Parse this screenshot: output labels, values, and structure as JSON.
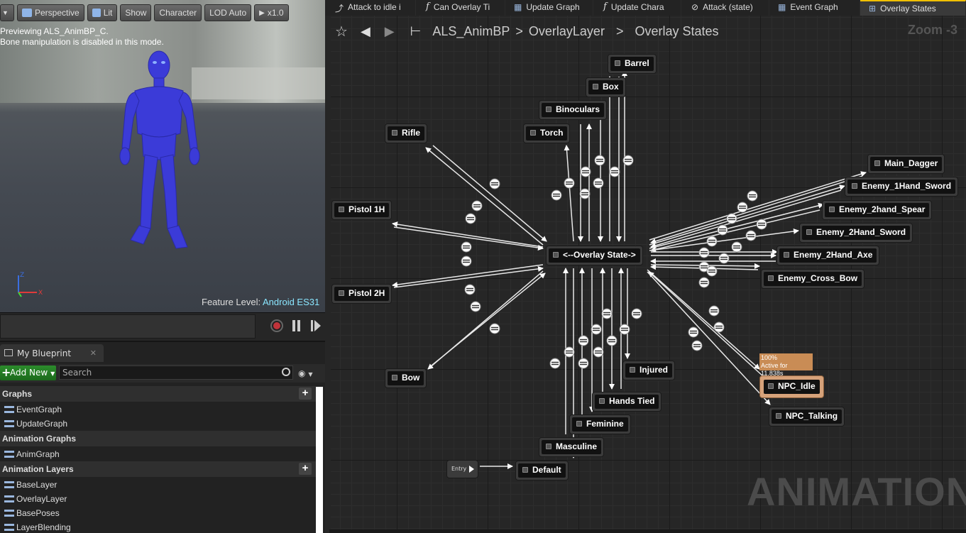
{
  "viewport": {
    "toolbar": {
      "perspective": "Perspective",
      "lit": "Lit",
      "show": "Show",
      "character": "Character",
      "lod": "LOD Auto",
      "speed": "x1.0"
    },
    "info_line1": "Previewing ALS_AnimBP_C.",
    "info_line2": "Bone manipulation is disabled in this mode.",
    "feature_label": "Feature Level:",
    "feature_value": "Android ES31"
  },
  "blueprint_panel": {
    "tab_label": "My Blueprint",
    "add_new": "Add New",
    "search_placeholder": "Search",
    "categories": {
      "graphs": "Graphs",
      "animation_graphs": "Animation Graphs",
      "animation_layers": "Animation Layers"
    },
    "graphs": [
      "EventGraph",
      "UpdateGraph"
    ],
    "anim_graphs": [
      "AnimGraph"
    ],
    "layers": [
      "BaseLayer",
      "OverlayLayer",
      "BasePoses",
      "LayerBlending"
    ]
  },
  "tabs": [
    {
      "icon": "transition-icon",
      "label": "Attack to idle i"
    },
    {
      "icon": "function-icon",
      "label": "Can Overlay Ti"
    },
    {
      "icon": "graph-icon",
      "label": "Update Graph"
    },
    {
      "icon": "function-icon",
      "label": "Update Chara"
    },
    {
      "icon": "state-icon",
      "label": "Attack (state)"
    },
    {
      "icon": "graph-icon",
      "label": "Event Graph"
    },
    {
      "icon": "state-machine-icon",
      "label": "Overlay States"
    }
  ],
  "breadcrumb": {
    "root": "ALS_AnimBP",
    "level1": "OverlayLayer",
    "level2": "Overlay States"
  },
  "zoom": "Zoom -3",
  "watermark": "ANIMATION",
  "active_state": {
    "percent": "100%",
    "active_for": "Active for 11.838s"
  },
  "entry_label": "Entry",
  "states": {
    "barrel": "Barrel",
    "box": "Box",
    "binoculars": "Binoculars",
    "torch": "Torch",
    "rifle": "Rifle",
    "pistol_1h": "Pistol 1H",
    "pistol_2h": "Pistol 2H",
    "bow": "Bow",
    "overlay_state": "<--Overlay State->",
    "main_dagger": "Main_Dagger",
    "enemy_1hand_sword": "Enemy_1Hand_Sword",
    "enemy_2hand_spear": "Enemy_2hand_Spear",
    "enemy_2hand_sword": "Enemy_2Hand_Sword",
    "enemy_2hand_axe": "Enemy_2Hand_Axe",
    "enemy_cross_bow": "Enemy_Cross_Bow",
    "npc_idle": "NPC_Idle",
    "npc_talking": "NPC_Talking",
    "injured": "Injured",
    "hands_tied": "Hands Tied",
    "feminine": "Feminine",
    "masculine": "Masculine",
    "default": "Default"
  }
}
